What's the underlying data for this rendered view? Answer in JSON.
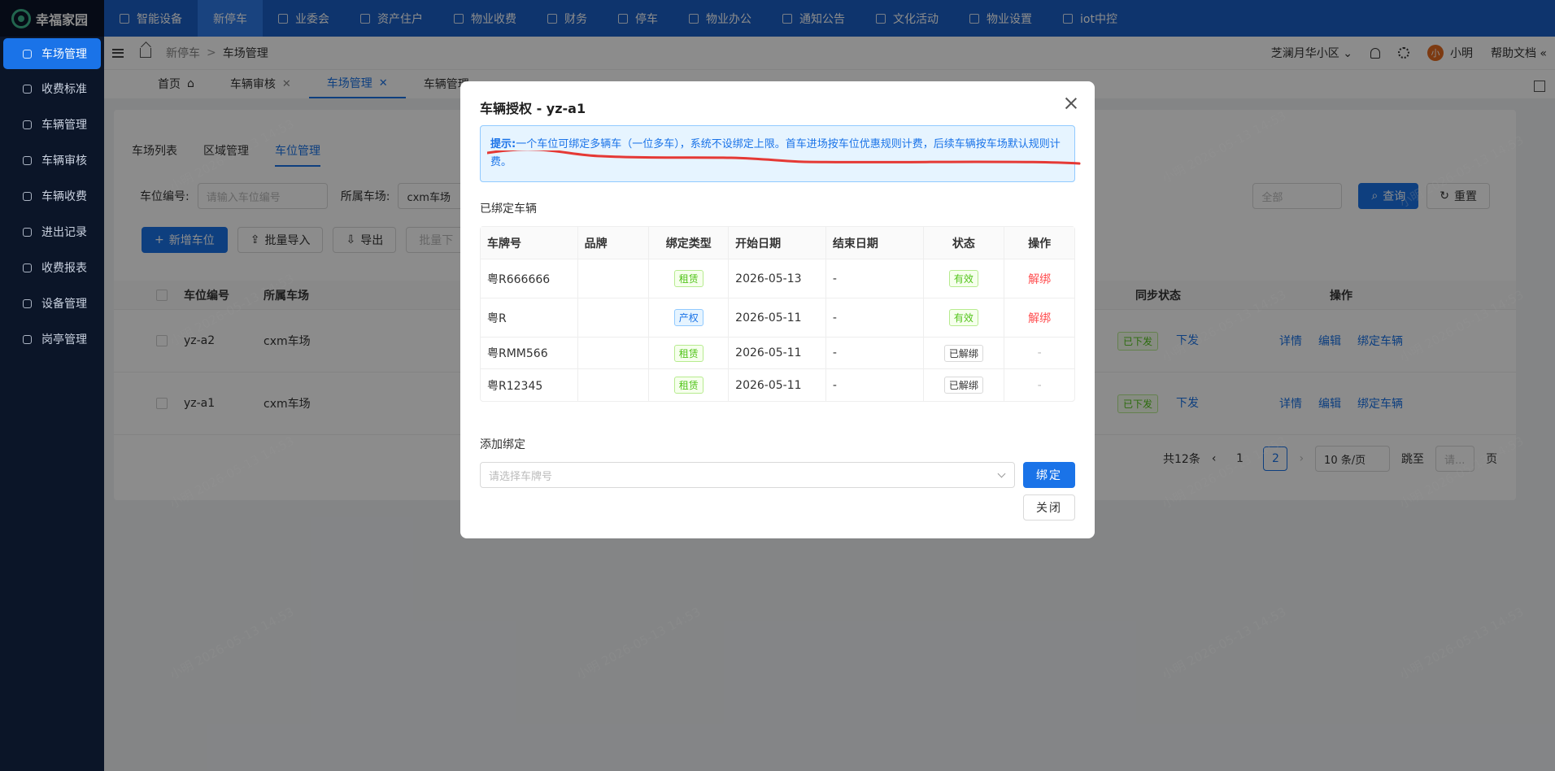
{
  "app": {
    "name": "幸福家园",
    "logo_icon": "sunflower-icon"
  },
  "topnav": [
    {
      "label": "智能设备",
      "icon": "device-icon",
      "active": false
    },
    {
      "label": "新停车",
      "icon": "",
      "active": true
    },
    {
      "label": "业委会",
      "icon": "committee-icon",
      "active": false
    },
    {
      "label": "资产住户",
      "icon": "home-icon",
      "active": false
    },
    {
      "label": "物业收费",
      "icon": "fee-icon",
      "active": false
    },
    {
      "label": "财务",
      "icon": "finance-icon",
      "active": false
    },
    {
      "label": "停车",
      "icon": "car-icon",
      "active": false
    },
    {
      "label": "物业办公",
      "icon": "monitor-icon",
      "active": false
    },
    {
      "label": "通知公告",
      "icon": "megaphone-icon",
      "active": false
    },
    {
      "label": "文化活动",
      "icon": "activity-icon",
      "active": false
    },
    {
      "label": "物业设置",
      "icon": "gear-icon",
      "active": false
    },
    {
      "label": "iot中控",
      "icon": "iot-icon",
      "active": false
    }
  ],
  "sidebar": [
    {
      "label": "车场管理",
      "active": true
    },
    {
      "label": "收费标准",
      "active": false
    },
    {
      "label": "车辆管理",
      "active": false
    },
    {
      "label": "车辆审核",
      "active": false
    },
    {
      "label": "车辆收费",
      "active": false
    },
    {
      "label": "进出记录",
      "active": false
    },
    {
      "label": "收费报表",
      "active": false
    },
    {
      "label": "设备管理",
      "active": false
    },
    {
      "label": "岗亭管理",
      "active": false
    }
  ],
  "header": {
    "breadcrumb": [
      "新停车",
      "车场管理"
    ],
    "community": "芝澜月华小区",
    "avatar_text": "小",
    "user": "小明",
    "help": "帮助文档"
  },
  "tabs": [
    {
      "label": "首页",
      "closable": false,
      "active": false
    },
    {
      "label": "车辆审核",
      "closable": true,
      "active": false
    },
    {
      "label": "车场管理",
      "closable": true,
      "active": true
    },
    {
      "label": "车辆管理",
      "closable": false,
      "active": false
    }
  ],
  "page": {
    "subtabs": [
      "车场列表",
      "区域管理",
      "车位管理"
    ],
    "active_subtab": "车位管理",
    "filter": {
      "space_no_label": "车位编号:",
      "space_no_placeholder": "请输入车位编号",
      "lot_label": "所属车场:",
      "lot_value": "cxm车场",
      "status_value": "全部",
      "query": "查询",
      "reset": "重置"
    },
    "toolbar": [
      "新增车位",
      "批量导入",
      "导出",
      "批量下"
    ],
    "table": {
      "headers": {
        "space_no": "车位编号",
        "lot": "所属车场",
        "sync": "同步状态",
        "ops": "操作"
      },
      "rows": [
        {
          "space_no": "yz-a2",
          "lot": "cxm车场",
          "sync": "已下发",
          "issue": "下发",
          "detail": "详情",
          "edit": "编辑",
          "bind": "绑定车辆"
        },
        {
          "space_no": "yz-a1",
          "lot": "cxm车场",
          "sync": "已下发",
          "issue": "下发",
          "detail": "详情",
          "edit": "编辑",
          "bind": "绑定车辆"
        }
      ]
    },
    "pager": {
      "total": "共12条",
      "pages": [
        "1",
        "2"
      ],
      "current": "2",
      "page_size": "10 条/页",
      "jump_label": "跳至",
      "jump_placeholder": "请...",
      "page_suffix": "页"
    }
  },
  "modal": {
    "title": "车辆授权 - yz-a1",
    "alert_prefix": "提示:",
    "alert_text": "一个车位可绑定多辆车（一位多车），系统不设绑定上限。首车进场按车位优惠规则计费，后续车辆按车场默认规则计费。",
    "bound_title": "已绑定车辆",
    "columns": [
      "车牌号",
      "品牌",
      "绑定类型",
      "开始日期",
      "结束日期",
      "状态",
      "操作"
    ],
    "rows": [
      {
        "plate": "粤R666666",
        "brand": "",
        "type": "租赁",
        "type_color": "green",
        "start": "2026-05-13",
        "end": "-",
        "status": "有效",
        "status_color": "green",
        "action": "解绑"
      },
      {
        "plate": "粤R",
        "brand": "",
        "type": "产权",
        "type_color": "blue",
        "start": "2026-05-11",
        "end": "-",
        "status": "有效",
        "status_color": "green",
        "action": "解绑"
      },
      {
        "plate": "粤RMM566",
        "brand": "",
        "type": "租赁",
        "type_color": "green",
        "start": "2026-05-11",
        "end": "-",
        "status": "已解绑",
        "status_color": "gray",
        "action": "-"
      },
      {
        "plate": "粤R12345",
        "brand": "",
        "type": "租赁",
        "type_color": "green",
        "start": "2026-05-11",
        "end": "-",
        "status": "已解绑",
        "status_color": "gray",
        "action": "-"
      }
    ],
    "add_title": "添加绑定",
    "plate_placeholder": "请选择车牌号",
    "bind_button": "绑定",
    "close_button": "关闭"
  },
  "watermark": "小明 2026-05-13 14:53"
}
